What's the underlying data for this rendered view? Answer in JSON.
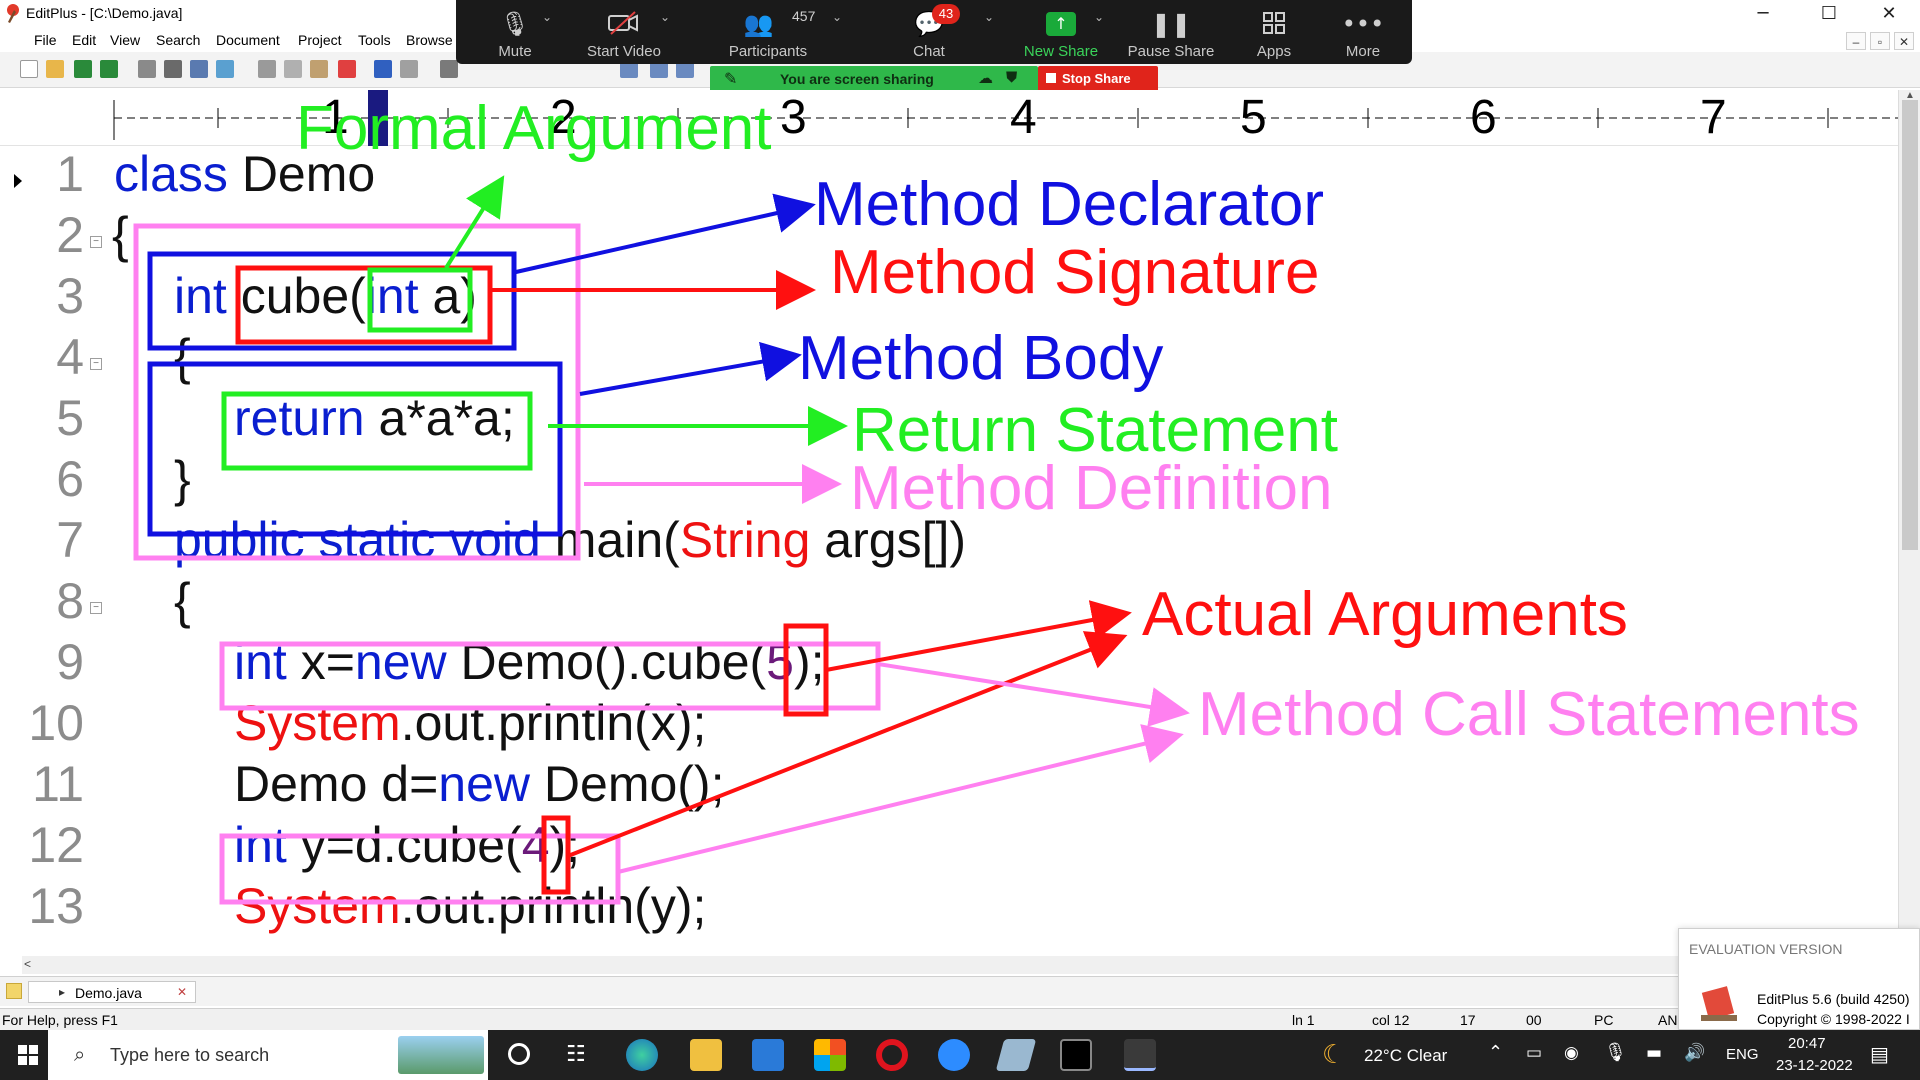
{
  "window": {
    "title": "EditPlus - [C:\\Demo.java]",
    "controls": {
      "minimize": "─",
      "maximize": "☐",
      "close": "✕",
      "mdi_min": "–",
      "mdi_restore": "▫",
      "mdi_close": "✕"
    }
  },
  "menu": [
    "File",
    "Edit",
    "View",
    "Search",
    "Document",
    "Project",
    "Tools",
    "Browse"
  ],
  "zoom": {
    "items": [
      {
        "label": "Mute",
        "icon": "microphone-icon"
      },
      {
        "label": "Start Video",
        "icon": "video-off-icon"
      },
      {
        "label": "Participants",
        "icon": "participants-icon"
      },
      {
        "label": "Chat",
        "icon": "chat-icon"
      },
      {
        "label": "New Share",
        "icon": "new-share-icon"
      },
      {
        "label": "Pause Share",
        "icon": "pause-icon"
      },
      {
        "label": "Apps",
        "icon": "apps-icon"
      },
      {
        "label": "More",
        "icon": "more-icon"
      }
    ],
    "participants_count": "457",
    "chat_badge": "43",
    "share_banner": "You are screen sharing",
    "stop_share": "Stop Share",
    "colors": {
      "bar": "#1a1a1a",
      "banner": "#2fb84a",
      "stop": "#e0241b",
      "new_share": "#1aaa3a"
    }
  },
  "ruler": {
    "numbers": [
      "1",
      "2",
      "3",
      "4",
      "5",
      "6",
      "7"
    ]
  },
  "editor": {
    "line_numbers": [
      "1",
      "2",
      "3",
      "4",
      "5",
      "6",
      "7",
      "8",
      "9",
      "10",
      "11",
      "12",
      "13"
    ],
    "lines": {
      "l1": {
        "kw": "class",
        "rest": " Demo"
      },
      "l2": {
        "rest": "{"
      },
      "l3": {
        "kw1": "int",
        "mid": " cube(",
        "kw2": "int",
        "rest": " a)"
      },
      "l4": {
        "rest": "{"
      },
      "l5": {
        "kw": "return",
        "rest": " a*a*a;"
      },
      "l6": {
        "rest": "}"
      },
      "l7": {
        "kw": "public static void",
        "mid": " main(",
        "cls": "String",
        "rest": " args[])"
      },
      "l8": {
        "rest": "{"
      },
      "l9": {
        "kw1": "int",
        "mid1": " x=",
        "kw2": "new",
        "mid2": " Demo().cube(",
        "num": "5",
        "rest": ");"
      },
      "l10": {
        "cls": "System",
        "rest": ".out.println(x);"
      },
      "l11": {
        "pre": "Demo d=",
        "kw": "new",
        "rest": " Demo();"
      },
      "l12": {
        "kw": "int",
        "mid": " y=d.cube(",
        "num": "4",
        "rest": ");"
      },
      "l13": {
        "cls": "System",
        "rest": ".out.println(y);"
      }
    },
    "colors": {
      "keyword": "#0a1ed0",
      "class": "#ee1111",
      "number": "#6b1a7a"
    }
  },
  "annotations": {
    "formal_argument": "Formal Argument",
    "method_declarator": "Method Declarator",
    "method_signature": "Method Signature",
    "method_body": "Method Body",
    "return_statement": "Return Statement",
    "method_definition": "Method Definition",
    "actual_arguments": "Actual Arguments",
    "method_call_statements": "Method Call Statements",
    "colors": {
      "green": "#22ee22",
      "blue": "#1010e0",
      "red": "#ff1010",
      "pink": "#ff80f0"
    }
  },
  "tabs": {
    "file": "Demo.java"
  },
  "status": {
    "help": "For Help, press F1",
    "ln": "ln 1",
    "col": "col 12",
    "n1": "17",
    "n2": "00",
    "mode": "PC",
    "enc": "AN"
  },
  "eval": {
    "title": "EVALUATION VERSION",
    "version": "EditPlus 5.6 (build 4250)",
    "copyright": "Copyright © 1998-2022 I"
  },
  "taskbar": {
    "search_placeholder": "Type here to search",
    "weather": "22°C  Clear",
    "lang": "ENG",
    "time": "20:47",
    "date": "23-12-2022"
  }
}
